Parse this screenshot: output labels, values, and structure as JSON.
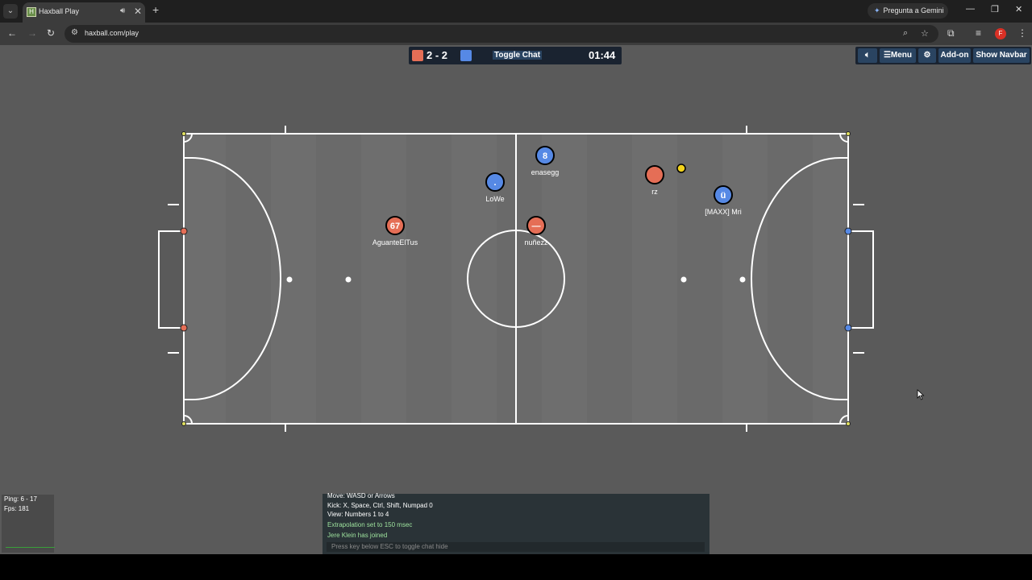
{
  "browser": {
    "tab_title": "Haxball Play",
    "tab_favicon": "H",
    "new_tab": "+",
    "gemini_label": "Pregunta a Gemini",
    "url": "haxball.com/play",
    "profile_initial": "F"
  },
  "scoreboard": {
    "red_color": "#e56e56",
    "blue_color": "#5689e5",
    "score": "2 - 2",
    "toggle_chat": "Toggle Chat",
    "time": "01:44"
  },
  "top_menu": {
    "sound_icon": "speaker-icon",
    "menu": "☰Menu",
    "settings_icon": "gear-icon",
    "addon": "Add-on",
    "show_navbar": "Show Navbar"
  },
  "players": [
    {
      "name": "AguanteElTus",
      "team": "red",
      "avatar": "67"
    },
    {
      "name": "nuñezz",
      "team": "red",
      "avatar": "—"
    },
    {
      "name": "rz",
      "team": "red",
      "avatar": ""
    },
    {
      "name": "LoWe",
      "team": "blue",
      "avatar": "."
    },
    {
      "name": "enasegg",
      "team": "blue",
      "avatar": "8"
    },
    {
      "name": "[MAXX] Mri",
      "team": "blue",
      "avatar": "ü"
    }
  ],
  "ball_color": "#f2d21b",
  "stats": {
    "ping": "Ping: 6 - 17",
    "fps": "Fps: 181"
  },
  "chat": {
    "lines": [
      {
        "text": "Move: WASD or Arrows",
        "style": "white"
      },
      {
        "text": "Kick: X, Space, Ctrl, Shift, Numpad 0",
        "style": "white"
      },
      {
        "text": "View: Numbers 1 to 4",
        "style": "white"
      },
      {
        "text": "Extrapolation set to 150 msec",
        "style": "green"
      },
      {
        "text": "Jere Klein has joined",
        "style": "green"
      }
    ],
    "input_placeholder": "Press key below ESC to toggle chat hide"
  }
}
